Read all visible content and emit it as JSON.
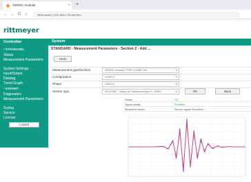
{
  "browser": {
    "tab_title": "X8000C modular",
    "tab_close": "×",
    "new_tab": "+",
    "address": "Nicht sicher | 192.168.1.1/index.htm",
    "nav": {
      "back": "←",
      "forward": "→",
      "reload": "C",
      "home": "⌂"
    }
  },
  "brand": {
    "logo": "rittmeyer",
    "accent": "#0f9a86"
  },
  "sidebar": {
    "header": "Controller",
    "section_standard": "• STANDARD",
    "items_standard": [
      "Status",
      "Measurement Parameters",
      "System Settings",
      "Input/Output",
      "Datalog",
      "Trend Graph"
    ],
    "section_expert": "• EXPERT",
    "items_expert": [
      "Diagnostics",
      "Measurement Parameters",
      "Syslog",
      "Service",
      "License"
    ],
    "logout": "Logout"
  },
  "main": {
    "bar_title": "System",
    "page_title": "STANDARD - Measurement Parameters - Section 2 - Add ...",
    "undo_button": "Undo"
  },
  "form": {
    "rows": [
      {
        "label": "Measurement type/function",
        "value": "X8000C modular TYPE CLAMP-ON"
      },
      {
        "label": "Configuration",
        "value": "X2/HF-2"
      },
      {
        "label": "Shape",
        "value": "CIRCLE"
      },
      {
        "label": "Sensor type",
        "value": "HK-47582 · Clamp-on Transducer type G, 2MHz"
      }
    ],
    "ok_button": "OK",
    "back_button": "Back"
  },
  "status": {
    "rows": [
      {
        "label": "Status",
        "value": "OK",
        "green": true
      },
      {
        "label": "Signal quality",
        "value": "Excellent",
        "green": true
      },
      {
        "label": "Measured values",
        "value": "Service signal: Excellent / ...",
        "green": false
      }
    ]
  },
  "chart_data": {
    "type": "line",
    "title": "",
    "xlabel": "",
    "ylabel": "",
    "x": [
      0,
      10,
      20,
      30,
      34,
      38,
      41,
      44,
      47,
      50,
      53,
      56,
      59,
      62,
      65,
      68,
      72,
      76,
      80,
      85,
      90,
      100
    ],
    "series": [
      {
        "name": "",
        "color": "#7a3ed0",
        "values": [
          0,
          0,
          0,
          0.02,
          -0.08,
          0.22,
          -0.4,
          0.62,
          -0.85,
          0.95,
          -0.7,
          0.55,
          -0.4,
          0.28,
          -0.18,
          0.12,
          -0.07,
          0.04,
          -0.02,
          0.01,
          0,
          0
        ]
      },
      {
        "name": "",
        "color": "#e0406a",
        "values": [
          0,
          0,
          0,
          0.01,
          -0.06,
          0.18,
          -0.33,
          0.52,
          -0.72,
          0.82,
          -0.6,
          0.46,
          -0.33,
          0.22,
          -0.14,
          0.09,
          -0.05,
          0.03,
          -0.01,
          0.01,
          0,
          0
        ]
      }
    ],
    "ylim": [
      -1,
      1
    ],
    "xlim": [
      0,
      100
    ],
    "grid": true
  }
}
